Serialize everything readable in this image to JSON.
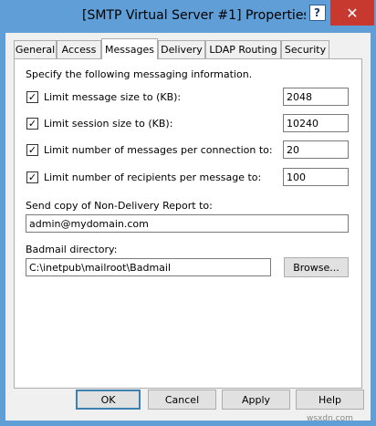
{
  "window": {
    "title": "[SMTP Virtual Server #1] Properties",
    "help_glyph": "?",
    "close_glyph": "✕"
  },
  "tabs": [
    {
      "label": "General"
    },
    {
      "label": "Access"
    },
    {
      "label": "Messages"
    },
    {
      "label": "Delivery"
    },
    {
      "label": "LDAP Routing"
    },
    {
      "label": "Security"
    }
  ],
  "messages": {
    "intro": "Specify the following messaging information.",
    "limits": [
      {
        "label": "Limit message size to (KB):",
        "checked": true,
        "value": "2048"
      },
      {
        "label": "Limit session size to (KB):",
        "checked": true,
        "value": "10240"
      },
      {
        "label": "Limit number of messages per connection to:",
        "checked": true,
        "value": "20"
      },
      {
        "label": "Limit number of recipients per message to:",
        "checked": true,
        "value": "100"
      }
    ],
    "ndr_label": "Send copy of Non-Delivery Report to:",
    "ndr_value": "admin@mydomain.com",
    "badmail_label": "Badmail directory:",
    "badmail_value": "C:\\inetpub\\mailroot\\Badmail",
    "browse_label": "Browse..."
  },
  "buttons": {
    "ok": "OK",
    "cancel": "Cancel",
    "apply": "Apply",
    "help": "Help"
  },
  "watermark": "wsxdn.com"
}
